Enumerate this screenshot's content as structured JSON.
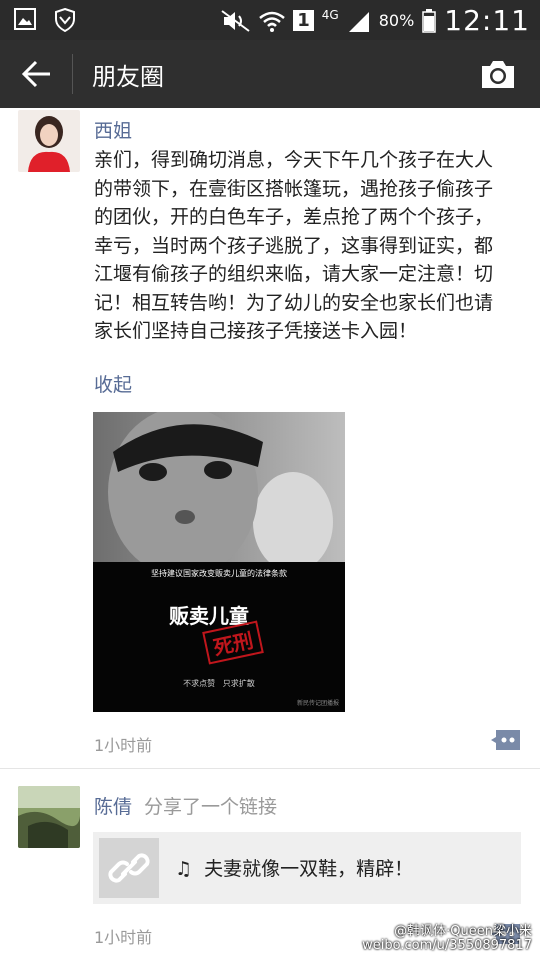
{
  "status_bar": {
    "network": "4G",
    "sim": "1",
    "battery": "80%",
    "time": "12:11"
  },
  "header": {
    "title": "朋友圈"
  },
  "posts": [
    {
      "author": "西姐",
      "text": "亲们，得到确切消息，今天下午几个孩子在大人的带领下，在壹街区搭帐篷玩，遇抢孩子偷孩子的团伙，开的白色车子，差点抢了两个个孩子，幸亏，当时两个孩子逃脱了，这事得到证实，都江堰有偷孩子的组织来临，请大家一定注意！切记！相互转告哟！为了幼儿的安全也家长们也请家长们坚持自己接孩子凭接送卡入园！",
      "collapse_label": "收起",
      "poster": {
        "caption": "坚持建议国家改变贩卖儿童的法律条款",
        "headline": "贩卖儿童",
        "stamp": "死刑",
        "slogan": "不求点赞   只求扩散",
        "footer": "新民传记团播报"
      },
      "time": "1小时前"
    },
    {
      "author": "陈倩",
      "share_note": "分享了一个链接",
      "link_title": "夫妻就像一双鞋，精辟！",
      "time": "1小时前"
    }
  ],
  "watermark": {
    "handle": "@韩讽体·Queen梁小米",
    "url": "weibo.com/u/3550897817"
  }
}
